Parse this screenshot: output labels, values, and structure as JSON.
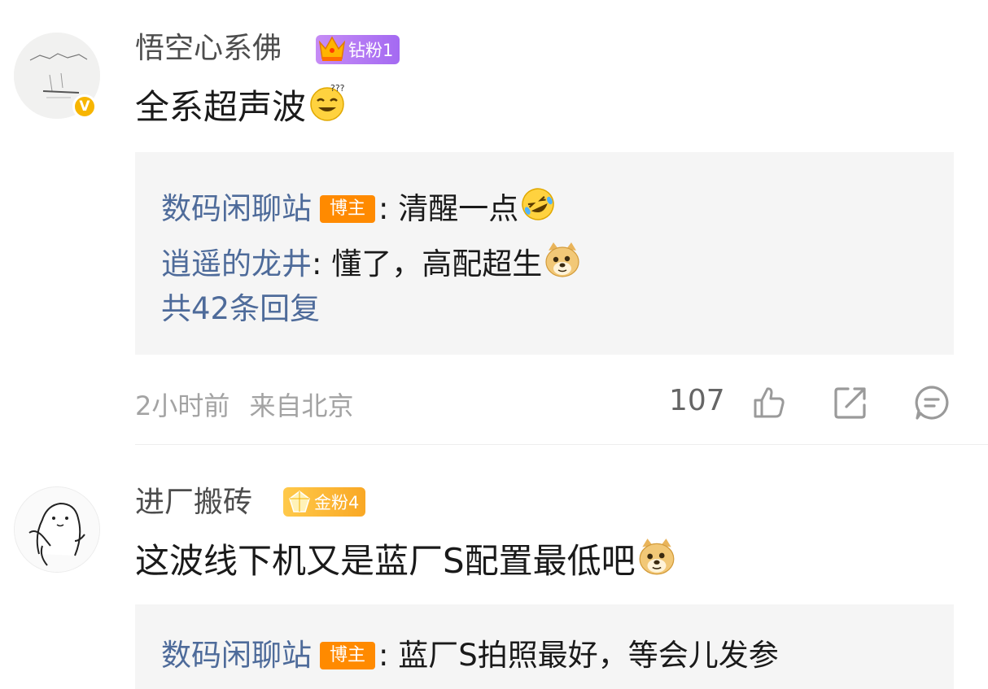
{
  "comments": [
    {
      "username": "悟空心系佛",
      "badge": "钻粉1",
      "text": "全系超声波",
      "replies": [
        {
          "name": "数码闲聊站",
          "tag": "博主",
          "text": ": 清醒一点"
        },
        {
          "name": "逍遥的龙井",
          "text": " : 懂了，高配超生"
        }
      ],
      "more_replies": "共42条回复",
      "time": "2小时前",
      "location": "来自北京",
      "likes": "107"
    },
    {
      "username": "进厂搬砖",
      "badge": "金粉4",
      "text": "这波线下机又是蓝厂S配置最低吧",
      "replies": [
        {
          "name": "数码闲聊站",
          "tag": "博主",
          "text": ": 蓝厂S拍照最好，等会儿发参"
        }
      ]
    }
  ],
  "colors": {
    "link": "#4e6b9a",
    "host_tag": "#ff8a00",
    "badge_diamond": "#b37cf3",
    "badge_gold": "#f9b32a",
    "reply_bg": "#f5f5f5"
  },
  "icons": [
    "verified-icon",
    "crown-icon",
    "gem-icon",
    "thumbs-up-icon",
    "share-icon",
    "comment-icon",
    "grinning-sweat-emoji",
    "rofl-emoji",
    "doge-emoji"
  ]
}
